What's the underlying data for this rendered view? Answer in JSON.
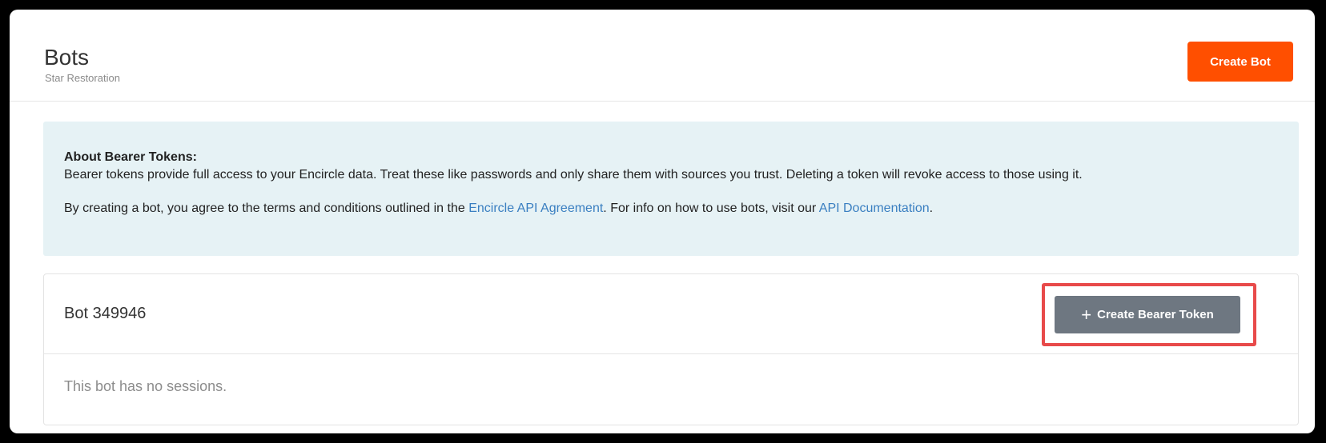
{
  "header": {
    "title": "Bots",
    "subtitle": "Star Restoration",
    "create_bot_label": "Create Bot"
  },
  "info": {
    "heading": "About Bearer Tokens:",
    "body": "Bearer tokens provide full access to your Encircle data. Treat these like passwords and only share them with sources you trust. Deleting a token will revoke access to those using it.",
    "agreement_prefix": "By creating a bot, you agree to the terms and conditions outlined in the ",
    "agreement_link": "Encircle API Agreement",
    "agreement_middle": ". For info on how to use bots, visit our ",
    "docs_link": "API Documentation",
    "agreement_suffix": "."
  },
  "bots": [
    {
      "name": "Bot 349946",
      "create_token_label": "Create Bearer Token",
      "empty_text": "This bot has no sessions."
    }
  ],
  "colors": {
    "accent": "#ff4f00",
    "secondary_button": "#6e7781",
    "link": "#3a7fc1",
    "info_background": "#e6f2f5",
    "highlight": "#e84a4a"
  },
  "icons": {
    "create_token_icon": "plus-icon"
  }
}
